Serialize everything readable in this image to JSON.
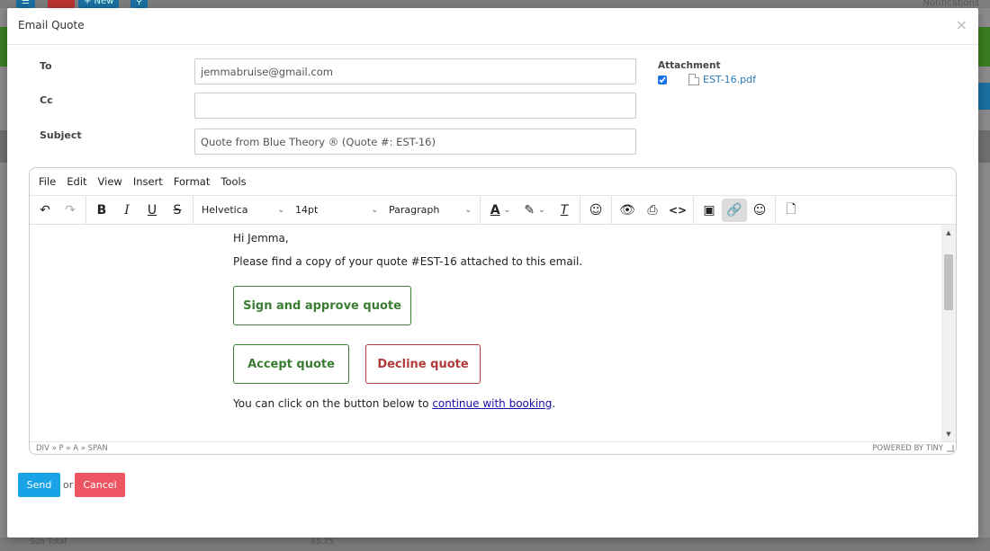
{
  "background": {
    "new_button": "+ New",
    "notifications": "Notifications",
    "bottom_label": "Sub Total",
    "bottom_value": "45.75"
  },
  "modal": {
    "title": "Email Quote",
    "close": "×"
  },
  "form": {
    "to_label": "To",
    "to_value": "jemmabruise@gmail.com",
    "cc_label": "Cc",
    "cc_value": "",
    "subject_label": "Subject",
    "subject_value": "Quote from Blue Theory ® (Quote #: EST-16)",
    "attachment_label": "Attachment",
    "attachment_file": "EST-16.pdf",
    "attachment_checked": true
  },
  "editor": {
    "menu": [
      "File",
      "Edit",
      "View",
      "Insert",
      "Format",
      "Tools"
    ],
    "font_family": "Helvetica",
    "font_size": "14pt",
    "block_format": "Paragraph",
    "content": {
      "greeting": "Hi Jemma,",
      "intro": "Please find a copy of your quote #EST-16 attached to this email.",
      "sign_button": "Sign and approve quote",
      "accept_button": "Accept quote",
      "decline_button": "Decline quote",
      "booking_prefix": "You can click on the button below to ",
      "booking_link": "continue with booking",
      "booking_suffix": "."
    },
    "status_path": "DIV » P » A » SPAN",
    "powered_by": "POWERED BY TINY"
  },
  "actions": {
    "send": "Send",
    "or": "or",
    "cancel": "Cancel"
  },
  "colors": {
    "send": "#17a3e6",
    "cancel": "#ee5562",
    "accept_green": "#3a7d32",
    "decline_red": "#b03a3a"
  }
}
